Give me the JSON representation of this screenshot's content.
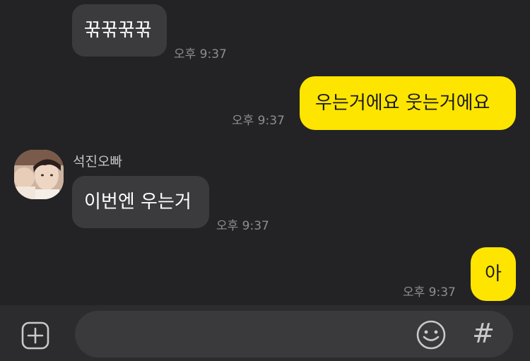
{
  "messages": [
    {
      "direction": "in",
      "text": "꾺꾺꾺꾺",
      "time": "오후 9:37"
    },
    {
      "direction": "out",
      "text": "우는거에요 웃는거에요",
      "time": "오후 9:37"
    },
    {
      "direction": "in",
      "sender": "석진오빠",
      "text": "이번엔 우는거",
      "time": "오후 9:37"
    },
    {
      "direction": "out",
      "text": "아",
      "time": "오후 9:37"
    }
  ],
  "composer": {
    "placeholder": "",
    "hash_label": "#"
  },
  "icons": {
    "add": "plus-square-icon",
    "emoji": "smiley-icon",
    "hash": "hash-icon"
  },
  "colors": {
    "background": "#232325",
    "incoming_bubble": "#3b3b3e",
    "outgoing_bubble": "#fee500",
    "timestamp": "#8e8e92"
  }
}
